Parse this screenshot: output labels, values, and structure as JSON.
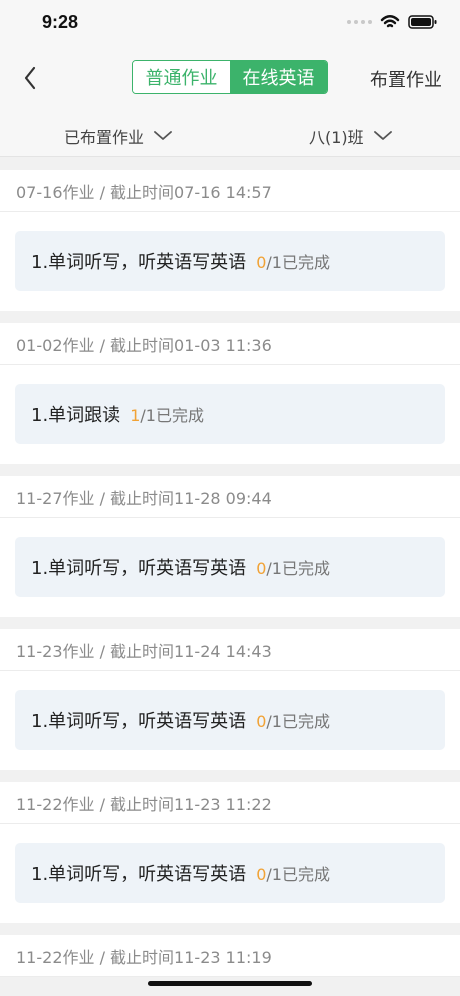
{
  "status_bar": {
    "time": "9:28",
    "icons": [
      "signal-dots-icon",
      "wifi-icon",
      "battery-icon"
    ]
  },
  "nav": {
    "back_icon": "chevron-left-icon",
    "tabs": [
      {
        "label": "普通作业",
        "active": false
      },
      {
        "label": "在线英语",
        "active": true
      }
    ],
    "assign_label": "布置作业"
  },
  "filters": {
    "left_label": "已布置作业",
    "left_icon": "chevron-down-icon",
    "right_label": "八(1)班",
    "right_icon": "chevron-down-icon"
  },
  "sections": [
    {
      "header": "07-16作业 / 截止时间07-16 14:57",
      "task_title": "1.单词听写，听英语写英语",
      "done": "0",
      "total": "/1已完成"
    },
    {
      "header": "01-02作业 / 截止时间01-03 11:36",
      "task_title": "1.单词跟读",
      "done": "1",
      "total": "/1已完成"
    },
    {
      "header": "11-27作业 / 截止时间11-28 09:44",
      "task_title": "1.单词听写，听英语写英语",
      "done": "0",
      "total": "/1已完成"
    },
    {
      "header": "11-23作业 / 截止时间11-24 14:43",
      "task_title": "1.单词听写，听英语写英语",
      "done": "0",
      "total": "/1已完成"
    },
    {
      "header": "11-22作业 / 截止时间11-23 11:22",
      "task_title": "1.单词听写，听英语写英语",
      "done": "0",
      "total": "/1已完成"
    },
    {
      "header": "11-22作业 / 截止时间11-23 11:19",
      "task_title": "",
      "done": "",
      "total": ""
    }
  ],
  "colors": {
    "accent": "#3cb36b",
    "progress": "#f1a235"
  }
}
